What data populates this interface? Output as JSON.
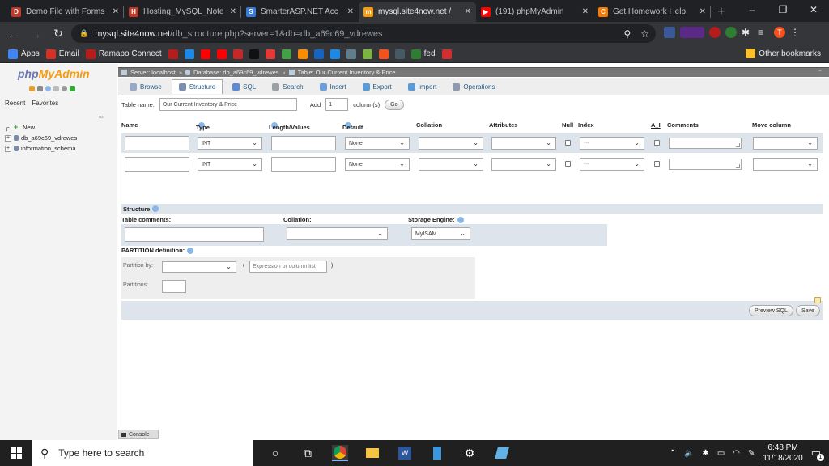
{
  "browser": {
    "tabs": [
      {
        "title": "Demo File with Forms",
        "color": "#c0392b",
        "glyph": "D"
      },
      {
        "title": "Hosting_MySQL_Note",
        "color": "#c0392b",
        "glyph": "H"
      },
      {
        "title": "SmarterASP.NET Acc",
        "color": "#3a7bd5",
        "glyph": "S"
      },
      {
        "title": "mysql.site4now.net /",
        "color": "#f89c0e",
        "glyph": "m"
      },
      {
        "title": "(191) phpMyAdmin",
        "color": "#ff0000",
        "glyph": "▶"
      },
      {
        "title": "Get Homework Help",
        "color": "#f57c00",
        "glyph": "C"
      }
    ],
    "new_tab": "+",
    "window_controls": [
      "–",
      "❐",
      "✕"
    ],
    "url_host": "mysql.site4now.net",
    "url_path": "/db_structure.php?server=1&db=db_a69c69_vdrewes",
    "bookmarks": [
      {
        "label": "Apps",
        "color": "#4285f4"
      },
      {
        "label": "Email",
        "color": "#d93025"
      },
      {
        "label": "Ramapo Connect",
        "color": "#b71c1c"
      },
      {
        "label": "",
        "color": "#b71c1c"
      },
      {
        "label": "",
        "color": "#1e88e5"
      },
      {
        "label": "",
        "color": "#ff0000"
      },
      {
        "label": "",
        "color": "#ff0000"
      },
      {
        "label": "",
        "color": "#c62828"
      },
      {
        "label": "",
        "color": "#111111"
      },
      {
        "label": "",
        "color": "#e53935"
      },
      {
        "label": "",
        "color": "#43a047"
      },
      {
        "label": "",
        "color": "#fb8c00"
      },
      {
        "label": "",
        "color": "#1565c0"
      },
      {
        "label": "",
        "color": "#1e88e5"
      },
      {
        "label": "",
        "color": "#607d8b"
      },
      {
        "label": "",
        "color": "#7cb342"
      },
      {
        "label": "",
        "color": "#f4511e"
      },
      {
        "label": "",
        "color": "#455a64"
      },
      {
        "label": "fed",
        "color": "#2e7d32"
      },
      {
        "label": "",
        "color": "#d32f2f"
      }
    ],
    "other_bookmarks": "Other bookmarks"
  },
  "sidebar": {
    "logo_php": "php",
    "logo_mya": "MyAdmin",
    "tabs": [
      "Recent",
      "Favorites"
    ],
    "link_icon": "∞",
    "tree": [
      {
        "label": "New",
        "kind": "new"
      },
      {
        "label": "db_a69c69_vdrewes",
        "kind": "db"
      },
      {
        "label": "information_schema",
        "kind": "db"
      }
    ]
  },
  "breadcrumb": {
    "server": "Server: localhost",
    "database": "Database: db_a69c69_vdrewes",
    "table": "Table: Our Current Inventory & Price"
  },
  "menu": [
    {
      "label": "Browse",
      "color": "#9aa8c8"
    },
    {
      "label": "Structure",
      "color": "#7b8fb0"
    },
    {
      "label": "SQL",
      "color": "#5b8ad6"
    },
    {
      "label": "Search",
      "color": "#9aa0a6"
    },
    {
      "label": "Insert",
      "color": "#6d9edb"
    },
    {
      "label": "Export",
      "color": "#5a9ad6"
    },
    {
      "label": "Import",
      "color": "#5a9ad6"
    },
    {
      "label": "Operations",
      "color": "#8d9ab0"
    }
  ],
  "form": {
    "table_name_label": "Table name:",
    "table_name_value": "Our Current Inventory & Price",
    "add_label": "Add",
    "add_value": "1",
    "columns_label": "column(s)",
    "go_label": "Go",
    "headers": {
      "name": "Name",
      "type": "Type",
      "length": "Length/Values",
      "default": "Default",
      "collation": "Collation",
      "attributes": "Attributes",
      "null": "Null",
      "index": "Index",
      "ai": "A_I",
      "comments": "Comments",
      "move": "Move column"
    },
    "rows": [
      {
        "type": "INT",
        "default": "None",
        "index": "---"
      },
      {
        "type": "INT",
        "default": "None",
        "index": "---"
      }
    ],
    "structure_label": "Structure",
    "table_comments_label": "Table comments:",
    "collation_label": "Collation:",
    "storage_engine_label": "Storage Engine:",
    "storage_engine_value": "MyISAM",
    "partition_label": "PARTITION definition:",
    "partition_by_label": "Partition by:",
    "partition_placeholder": "Expression or column list",
    "partition_open": "(",
    "partition_close": ")",
    "partitions_label": "Partitions:",
    "preview_sql": "Preview SQL",
    "save": "Save",
    "console": "Console"
  },
  "taskbar": {
    "search_placeholder": "Type here to search",
    "time": "6:48 PM",
    "date": "11/18/2020",
    "notification_count": "1"
  }
}
